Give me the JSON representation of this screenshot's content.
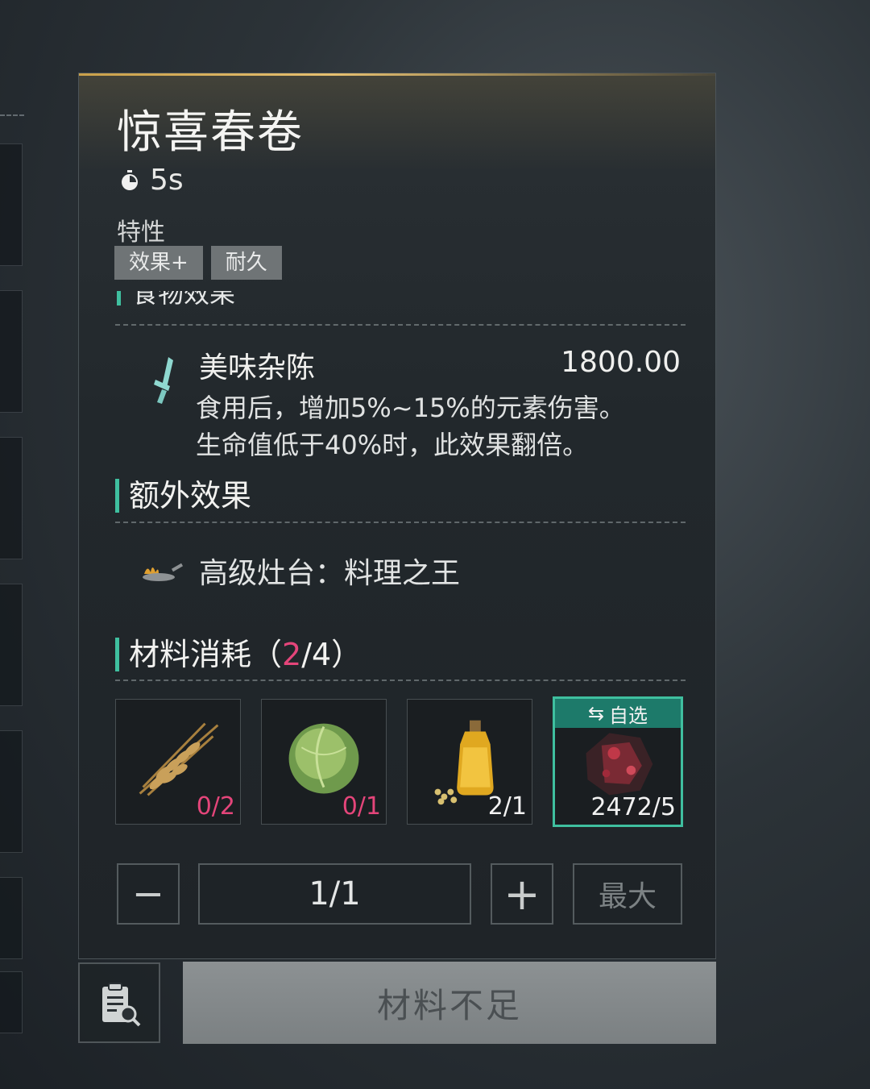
{
  "recipe": {
    "title": "惊喜春卷",
    "time": "5s",
    "traits_label": "特性",
    "traits": [
      "效果+",
      "耐久"
    ],
    "food_effect_heading": "食物效果",
    "effect": {
      "name": "美味杂陈",
      "value": "1800.00",
      "desc_line1": "食用后，增加5%~15%的元素伤害。",
      "desc_line2": "生命值低于40%时，此效果翻倍。",
      "icon": "blade-icon"
    }
  },
  "extra": {
    "heading": "额外效果",
    "text": "高级灶台：料理之王",
    "icon": "stove-icon"
  },
  "materials": {
    "heading_prefix": "材料消耗（",
    "have": "2",
    "sep_total": "/4）",
    "items": [
      {
        "icon": "wheat-icon",
        "count": "0/2",
        "insufficient": true
      },
      {
        "icon": "cabbage-icon",
        "count": "0/1",
        "insufficient": true
      },
      {
        "icon": "oil-bottle-icon",
        "count": "2/1",
        "insufficient": false
      },
      {
        "icon": "red-ore-icon",
        "count": "2472/5",
        "insufficient": false,
        "selected": true,
        "select_label": "自选"
      }
    ]
  },
  "quantity": {
    "minus": "−",
    "value": "1/1",
    "plus": "+",
    "max": "最大"
  },
  "action": {
    "craft_label": "材料不足"
  },
  "colors": {
    "accent": "#3fbf9f",
    "warning": "#e4457a",
    "gold": "#c9a04a"
  }
}
